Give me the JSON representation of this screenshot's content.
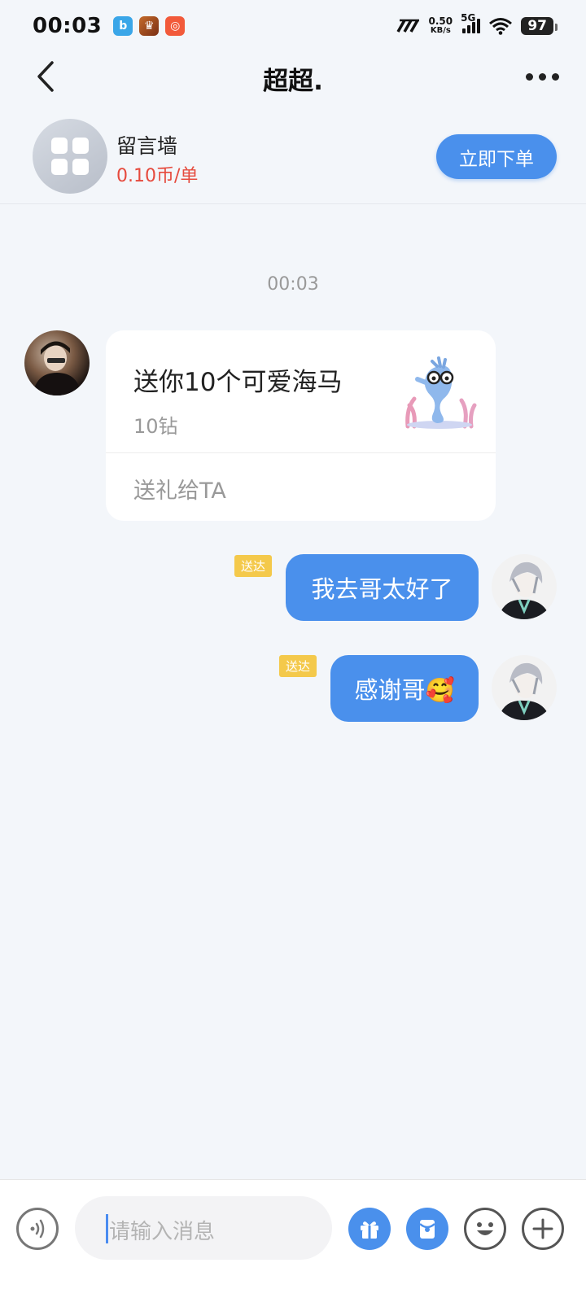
{
  "status_bar": {
    "time": "00:03",
    "net_speed_value": "0.50",
    "net_speed_unit": "KB/s",
    "network": "5G",
    "battery": "97",
    "app_icons": [
      "maps-app-icon",
      "game-app-icon",
      "kuaishou-app-icon"
    ]
  },
  "header": {
    "title": "超超."
  },
  "service": {
    "name": "留言墙",
    "price": "0.10币/单",
    "order_button": "立即下单"
  },
  "chat": {
    "timestamp": "00:03",
    "gift": {
      "title": "送你10个可爱海马",
      "price": "10钻",
      "action": "送礼给TA"
    },
    "messages": [
      {
        "text": "我去哥太好了",
        "status": "送达"
      },
      {
        "text": "感谢哥🥰",
        "status": "送达"
      }
    ]
  },
  "input_bar": {
    "placeholder": "请输入消息"
  },
  "colors": {
    "accent": "#4a90ec",
    "price_red": "#e64a3d",
    "badge_yellow": "#f4c94b",
    "background": "#f3f6fa"
  }
}
